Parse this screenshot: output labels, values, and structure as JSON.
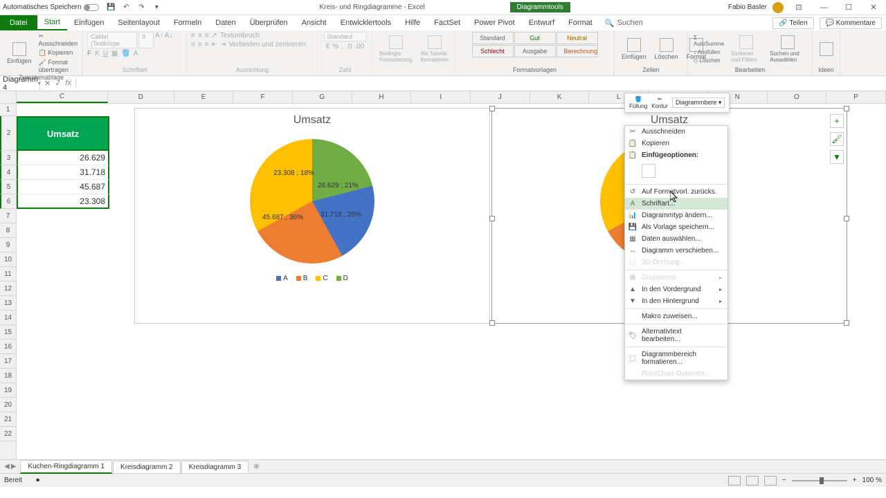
{
  "titlebar": {
    "autosave": "Automatisches Speichern",
    "doc_title": "Kreis- und Ringdiagramme - Excel",
    "tool_context": "Diagrammtools",
    "user": "Fabio Basler"
  },
  "tabs": {
    "file": "Datei",
    "items": [
      "Start",
      "Einfügen",
      "Seitenlayout",
      "Formeln",
      "Daten",
      "Überprüfen",
      "Ansicht",
      "Entwicklertools",
      "Hilfe",
      "FactSet",
      "Power Pivot",
      "Entwurf",
      "Format"
    ],
    "search": "Suchen",
    "share": "Teilen",
    "comments": "Kommentare"
  },
  "ribbon": {
    "clipboard": {
      "paste": "Einfügen",
      "cut": "Ausschneiden",
      "copy": "Kopieren",
      "format_painter": "Format übertragen",
      "label": "Zwischenablage"
    },
    "font": {
      "name": "Calibri (Textkörpe",
      "size": "9",
      "label": "Schriftart"
    },
    "align": {
      "wrap": "Textumbruch",
      "merge": "Verbinden und zentrieren",
      "label": "Ausrichtung"
    },
    "number": {
      "format": "Standard",
      "label": "Zahl"
    },
    "cond": {
      "cond": "Bedingte Formatierung",
      "table": "Als Tabelle formatieren",
      "label": "Formatvorlagen"
    },
    "styles": {
      "standard": "Standard",
      "gut": "Gut",
      "neutral": "Neutral",
      "schlecht": "Schlecht",
      "ausgabe": "Ausgabe",
      "berechnung": "Berechnung"
    },
    "cells": {
      "insert": "Einfügen",
      "delete": "Löschen",
      "format": "Format",
      "label": "Zellen"
    },
    "editing": {
      "sum": "AutoSumme",
      "fill": "Ausfüllen",
      "clear": "Löschen",
      "sort": "Sortieren und Filtern",
      "find": "Suchen und Auswählen",
      "label": "Bearbeiten"
    },
    "ideas": {
      "label": "Ideen"
    }
  },
  "formula_bar": {
    "name_box": "Diagramm 4"
  },
  "columns": [
    "C",
    "D",
    "E",
    "F",
    "G",
    "H",
    "I",
    "J",
    "K",
    "L",
    "M",
    "N",
    "O",
    "P"
  ],
  "rows": [
    "1",
    "2",
    "3",
    "4",
    "5",
    "6",
    "7",
    "8",
    "9",
    "10",
    "11",
    "12",
    "13",
    "14",
    "15",
    "16",
    "17",
    "18",
    "19",
    "20",
    "21",
    "22"
  ],
  "data": {
    "header": "Umsatz",
    "values": [
      "26.629",
      "31.718",
      "45.687",
      "23.308"
    ]
  },
  "chart_data": {
    "type": "pie",
    "title": "Umsatz",
    "series": [
      {
        "name": "Umsatz",
        "values": [
          26629,
          31718,
          45687,
          23308
        ]
      }
    ],
    "categories": [
      "A",
      "B",
      "C",
      "D"
    ],
    "data_labels": [
      "26.629 ; 21%",
      "31.718 ; 25%",
      "45.687 ; 36%",
      "23.308 ; 18%"
    ],
    "colors": [
      "#4472c4",
      "#ed7d31",
      "#ffc000",
      "#70ad47"
    ],
    "legend_position": "bottom"
  },
  "mini_toolbar": {
    "fill": "Füllung",
    "outline": "Kontur",
    "area": "Diagrammbere"
  },
  "context_menu": {
    "cut": "Ausschneiden",
    "copy": "Kopieren",
    "paste_opts": "Einfügeoptionen:",
    "reset": "Auf Formatvorl. zurücks.",
    "font": "Schriftart...",
    "change_type": "Diagrammtyp ändern...",
    "save_template": "Als Vorlage speichern...",
    "select_data": "Daten auswählen...",
    "move_chart": "Diagramm verschieben...",
    "rotation_3d": "3D-Drehung...",
    "group": "Gruppieren",
    "foreground": "In den Vordergrund",
    "background": "In den Hintergrund",
    "macro": "Makro zuweisen...",
    "alt_text": "Alternativtext bearbeiten...",
    "format_area": "Diagrammbereich formatieren...",
    "pivot_opts": "PivotChart-Optionen..."
  },
  "sheets": {
    "tabs": [
      "Kuchen-Ringdiagramm 1",
      "Kreisdiagramm 2",
      "Kreisdiagramm 3"
    ]
  },
  "status": {
    "ready": "Bereit",
    "zoom": "100 %"
  }
}
